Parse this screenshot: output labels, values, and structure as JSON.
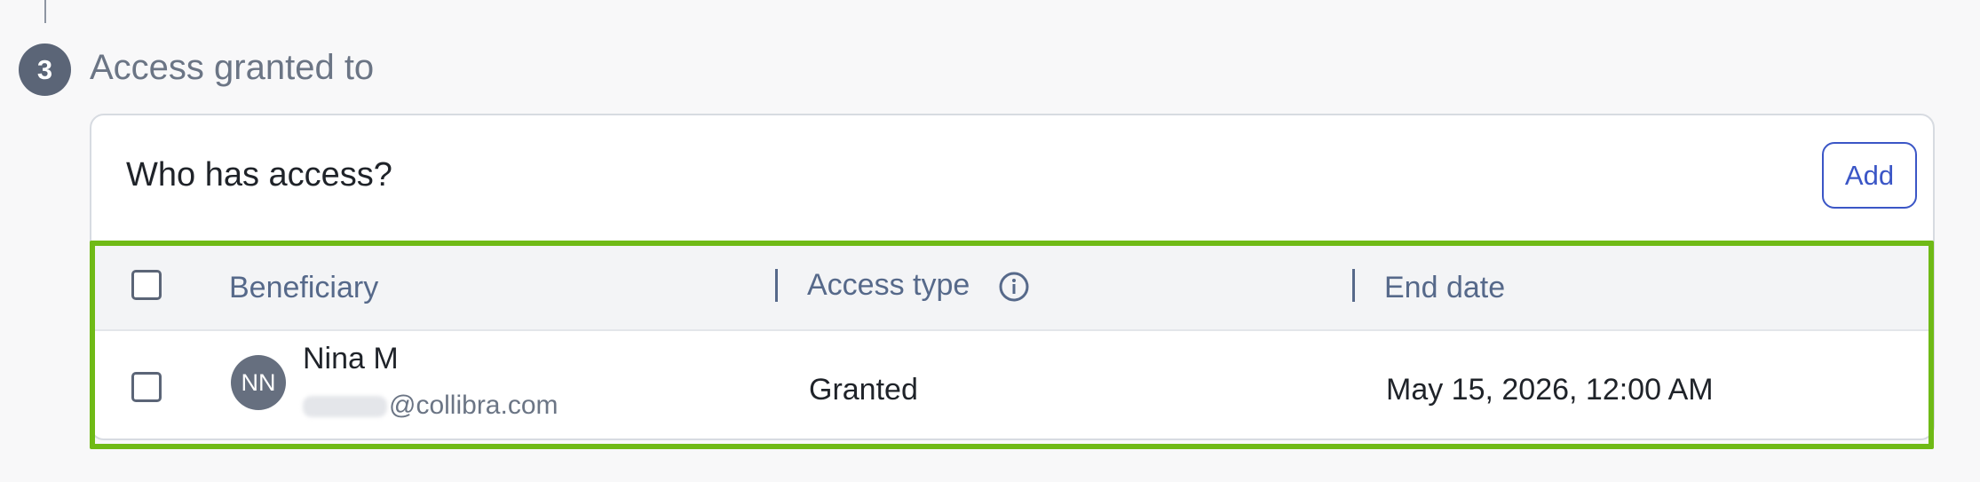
{
  "step": {
    "number": "3",
    "title": "Access granted to"
  },
  "card": {
    "title": "Who has access?",
    "add_label": "Add"
  },
  "table": {
    "columns": [
      "Beneficiary",
      "Access type",
      "End date"
    ],
    "rows": [
      {
        "avatar_initials": "NN",
        "name": "Nina M",
        "email_visible": "@collibra.com",
        "access_type": "Granted",
        "end_date": "May 15, 2026, 12:00 AM"
      }
    ]
  },
  "colors": {
    "accent": "#3b56c6",
    "highlight_border": "#6fba16",
    "header_text": "#56698a"
  },
  "icons": {
    "access_type_info": "info-icon"
  }
}
